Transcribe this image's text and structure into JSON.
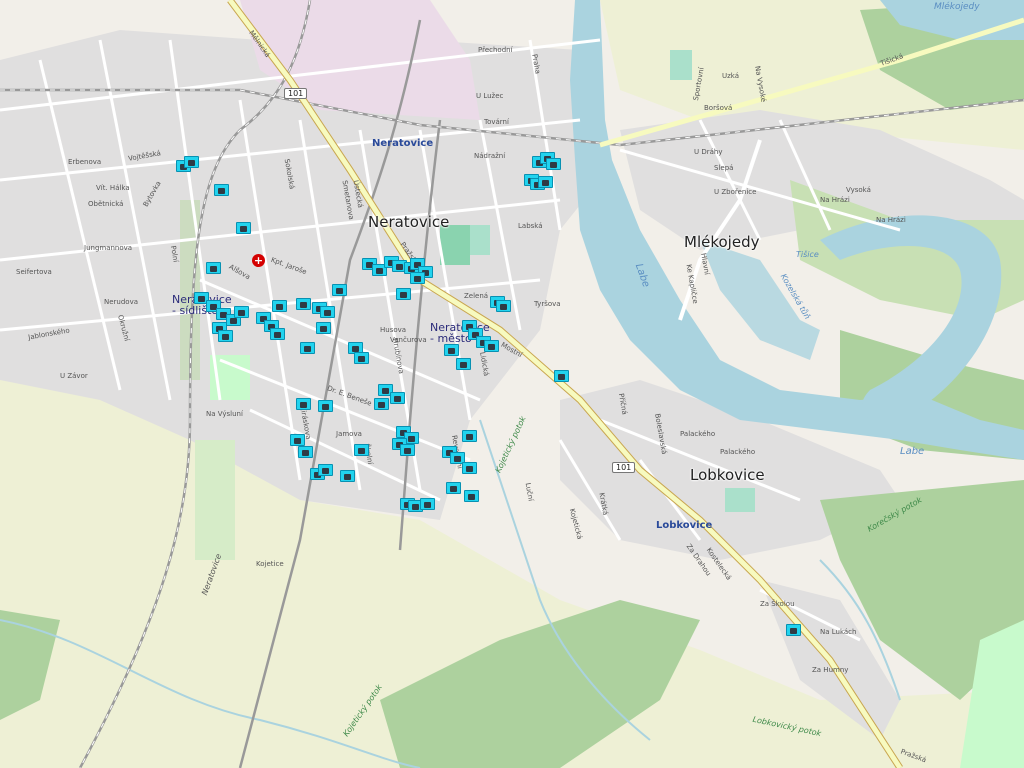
{
  "places": {
    "neratovice": "Neratovice",
    "mlekojedy": "Mlékojedy",
    "lobkovice": "Lobkovice"
  },
  "districts": {
    "sidliste": "Neratovice - sídliště",
    "mesto": "Neratovice - město"
  },
  "stations": {
    "neratovice": "Neratovice",
    "lobkovice": "Lobkovice"
  },
  "road_numbers": [
    "101",
    "101"
  ],
  "water_labels": [
    "Labe",
    "Labe",
    "Mlékojedy",
    "Kozelská tůň",
    "Tišice"
  ],
  "green_labels": [
    "Lobkovický potok",
    "Kojetický potok",
    "Korečský potok",
    "Kojetický potok"
  ],
  "rail_label": "Neratovice",
  "streets": [
    "Mělnická",
    "Na Výsluní",
    "Kostelecká",
    "Kojetice",
    "Bytovka",
    "Vojtěšská",
    "Přechodní",
    "U Lužec",
    "Nádražní",
    "Praha",
    "Tovární",
    "Labská",
    "Zelená",
    "Kpt. Jaroše",
    "Dr. E. Beneše",
    "U Závor",
    "Palackého",
    "Na Hrázi",
    "Boršová",
    "U Zbořenice",
    "Hlavní",
    "Na Vysoké",
    "Sokolská",
    "Ústecká",
    "Pražská",
    "Husova",
    "Mostní",
    "Revoluční",
    "U Dráhy",
    "Slepá",
    "Za Školou",
    "Polní",
    "Okružní",
    "Jiráskova",
    "Lidická",
    "Kojetická",
    "Alšova",
    "Tyršova",
    "Palackého",
    "Školní",
    "Boleslavská",
    "Krátká",
    "Luční",
    "Jungmannova",
    "Erbenova",
    "Vít. Hálka",
    "Obětnická",
    "Seifertova",
    "Jablonského",
    "Nerudova",
    "Hrubínova",
    "Vančurova",
    "Jamova",
    "Na Hrázi",
    "Tišická",
    "Uzká",
    "Sportovní",
    "Na Lukách",
    "Za Humny",
    "Ke Kapličce",
    "Za Drahou",
    "Vysoká",
    "Příčná",
    "Smetanova",
    "Pražská"
  ],
  "markers": [
    {
      "area": "Vojtěšská",
      "count": 2
    },
    {
      "area": "Bytovka",
      "count": 1
    },
    {
      "area": "Kpt. Jaroše",
      "count": 12
    },
    {
      "area": "Nádražní",
      "count": 6
    },
    {
      "area": "Dr. E. Beneše",
      "count": 28
    },
    {
      "area": "Lidická",
      "count": 14
    },
    {
      "area": "Tyršova",
      "count": 8
    },
    {
      "area": "Palackého",
      "count": 1
    },
    {
      "area": "Za Školou",
      "count": 1
    }
  ],
  "colors": {
    "marker": "#22d3ee",
    "water": "#aad3df",
    "forest": "#add19e",
    "park": "#c8facc",
    "residential": "#e0dfdf",
    "industrial": "#ebdbe8",
    "highway": "#f7fabf"
  }
}
